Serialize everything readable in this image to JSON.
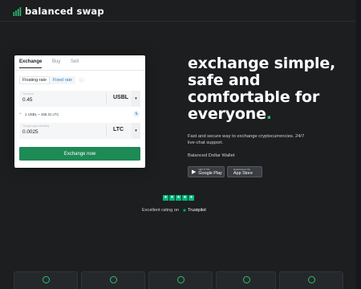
{
  "brand": {
    "name": "balanced swap",
    "icon": "chart-bars-icon",
    "accent": "#2fbf71"
  },
  "widget": {
    "tabs": [
      {
        "label": "Exchange",
        "active": true
      },
      {
        "label": "Buy",
        "active": false
      },
      {
        "label": "Sell",
        "active": false
      }
    ],
    "rate_type": {
      "floating": "Floating rate",
      "fixed": "Fixed rate",
      "info_icon": "info-icon"
    },
    "send": {
      "label": "You send",
      "amount": "0.45",
      "currency": "USBL"
    },
    "rate_text": "1 USBL ~ 165.31 LTC",
    "receive": {
      "label": "You get approximately",
      "amount": "0.0025",
      "currency": "LTC"
    },
    "submit": "Exchange now"
  },
  "hero": {
    "title_lines": [
      "exchange simple,",
      "safe and",
      "comfortable for",
      "everyone"
    ],
    "title_dot": ".",
    "subtitle": "Fast and secure way to exchange cryptocurrencies. 24/7 live-chat support.",
    "wallet_label": "Balanced Dollar Wallet",
    "google_play": {
      "small": "GET IT ON",
      "big": "Google Play"
    },
    "app_store": {
      "small": "Download on the",
      "big": "App Store"
    }
  },
  "trust": {
    "stars": 5,
    "text": "Excellent rating on",
    "brand": "Trustpilot",
    "color": "#00b67a"
  },
  "colors": {
    "primary_button": "#1e8a56",
    "background": "#1c1e20"
  }
}
